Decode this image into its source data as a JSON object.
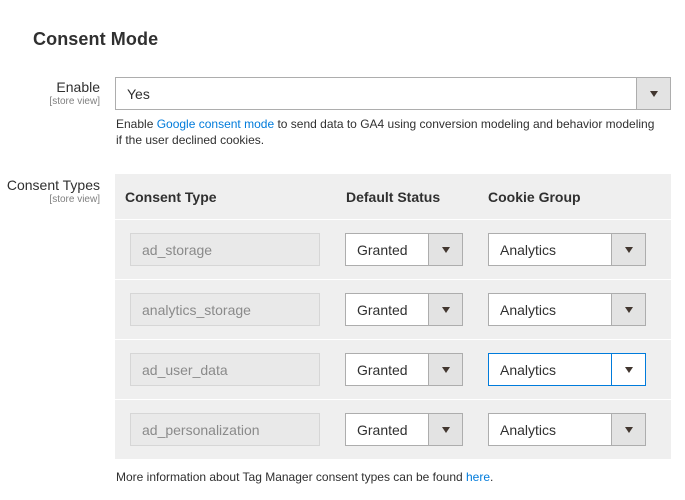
{
  "section": {
    "title": "Consent Mode"
  },
  "enable": {
    "label": "Enable",
    "scope": "[store view]",
    "value": "Yes",
    "note_prefix": "Enable ",
    "note_link": "Google consent mode",
    "note_suffix": " to send data to GA4 using conversion modeling and behavior modeling if the user declined cookies."
  },
  "consent_types": {
    "label": "Consent Types",
    "scope": "[store view]",
    "headers": {
      "type": "Consent Type",
      "status": "Default Status",
      "group": "Cookie Group"
    },
    "rows": [
      {
        "type": "ad_storage",
        "status": "Granted",
        "group": "Analytics"
      },
      {
        "type": "analytics_storage",
        "status": "Granted",
        "group": "Analytics"
      },
      {
        "type": "ad_user_data",
        "status": "Granted",
        "group": "Analytics"
      },
      {
        "type": "ad_personalization",
        "status": "Granted",
        "group": "Analytics"
      }
    ],
    "footer_prefix": "More information about Tag Manager consent types can be found ",
    "footer_link": "here",
    "footer_suffix": "."
  },
  "colors": {
    "link": "#007bdb",
    "focus_border": "#007bdb",
    "grid_bg": "#efefef"
  }
}
